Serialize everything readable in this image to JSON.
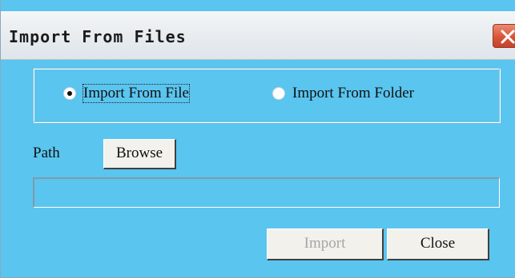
{
  "window": {
    "title": "Import From Files",
    "accent_color": "#5ac5ef"
  },
  "options": {
    "import_from_file": "Import From File",
    "import_from_folder": "Import From Folder",
    "selected": "import_from_file"
  },
  "path": {
    "label": "Path",
    "browse_label": "Browse",
    "value": ""
  },
  "actions": {
    "import_label": "Import",
    "import_enabled": false,
    "close_label": "Close"
  }
}
